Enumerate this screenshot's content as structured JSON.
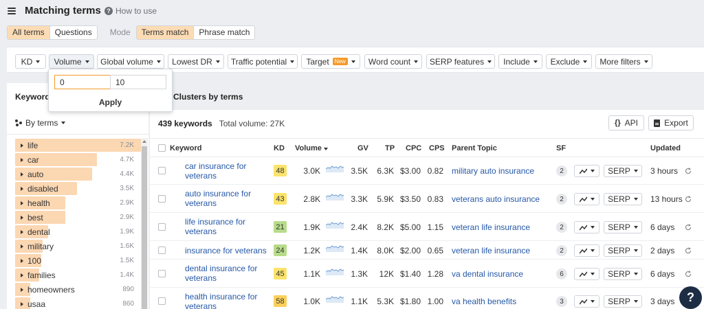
{
  "header": {
    "title": "Matching terms",
    "howto": "How to use"
  },
  "modes": {
    "match_tabs": [
      "All terms",
      "Questions"
    ],
    "mode_label": "Mode",
    "mode_tabs": [
      "Terms match",
      "Phrase match"
    ]
  },
  "filters": [
    {
      "label": "KD"
    },
    {
      "label": "Volume"
    },
    {
      "label": "Global volume"
    },
    {
      "label": "Lowest DR"
    },
    {
      "label": "Traffic potential"
    },
    {
      "label": "Target",
      "badge": "New"
    },
    {
      "label": "Word count"
    },
    {
      "label": "SERP features"
    },
    {
      "label": "Include"
    },
    {
      "label": "Exclude"
    },
    {
      "label": "More filters"
    }
  ],
  "volume_popup": {
    "from_value": "0",
    "to_value": "10",
    "apply_label": "Apply"
  },
  "left_panel": {
    "title": "Keywords",
    "group_by": "By terms",
    "terms": [
      {
        "name": "life",
        "count": "7.2K",
        "share": 1.0
      },
      {
        "name": "car",
        "count": "4.7K",
        "share": 0.65
      },
      {
        "name": "auto",
        "count": "4.4K",
        "share": 0.61
      },
      {
        "name": "disabled",
        "count": "3.5K",
        "share": 0.49
      },
      {
        "name": "health",
        "count": "2.9K",
        "share": 0.4
      },
      {
        "name": "best",
        "count": "2.9K",
        "share": 0.4
      },
      {
        "name": "dental",
        "count": "1.9K",
        "share": 0.26
      },
      {
        "name": "military",
        "count": "1.6K",
        "share": 0.22
      },
      {
        "name": "100",
        "count": "1.5K",
        "share": 0.21
      },
      {
        "name": "families",
        "count": "1.4K",
        "share": 0.19
      },
      {
        "name": "homeowners",
        "count": "890",
        "share": 0.12
      },
      {
        "name": "usaa",
        "count": "860",
        "share": 0.12
      }
    ]
  },
  "clusters_title": "Clusters by terms",
  "summary": {
    "keywords": "439 keywords",
    "total_volume": "Total volume: 27K"
  },
  "buttons": {
    "api": "API",
    "api_icon": "{}",
    "export": "Export"
  },
  "columns": {
    "keyword": "Keyword",
    "kd": "KD",
    "volume": "Volume",
    "gv": "GV",
    "tp": "TP",
    "cpc": "CPC",
    "cps": "CPS",
    "parent": "Parent Topic",
    "sf": "SF",
    "updated": "Updated"
  },
  "rows": [
    {
      "keyword": "car insurance for veterans",
      "kd": "48",
      "kd_color": "#fbe36c",
      "volume": "3.0K",
      "gv": "3.5K",
      "tp": "6.3K",
      "cpc": "$3.00",
      "cps": "0.82",
      "parent": "military auto insurance",
      "sf": "2",
      "serp": "SERP",
      "updated": "3 hours"
    },
    {
      "keyword": "auto insurance for veterans",
      "kd": "43",
      "kd_color": "#fbe36c",
      "volume": "2.8K",
      "gv": "3.3K",
      "tp": "5.9K",
      "cpc": "$3.50",
      "cps": "0.83",
      "parent": "veterans auto insurance",
      "sf": "2",
      "serp": "SERP",
      "updated": "13 hours"
    },
    {
      "keyword": "life insurance for veterans",
      "kd": "21",
      "kd_color": "#b7dc8a",
      "volume": "1.9K",
      "gv": "2.4K",
      "tp": "8.2K",
      "cpc": "$5.00",
      "cps": "1.15",
      "parent": "veteran life insurance",
      "sf": "2",
      "serp": "SERP",
      "updated": "6 days"
    },
    {
      "keyword": "insurance for veterans",
      "kd": "24",
      "kd_color": "#b7dc8a",
      "volume": "1.2K",
      "gv": "1.4K",
      "tp": "8.0K",
      "cpc": "$2.00",
      "cps": "0.65",
      "parent": "veteran life insurance",
      "sf": "2",
      "serp": "SERP",
      "updated": "2 days"
    },
    {
      "keyword": "dental insurance for veterans",
      "kd": "45",
      "kd_color": "#fbe36c",
      "volume": "1.1K",
      "gv": "1.3K",
      "tp": "12K",
      "cpc": "$1.40",
      "cps": "1.28",
      "parent": "va dental insurance",
      "sf": "6",
      "serp": "SERP",
      "updated": "6 days"
    },
    {
      "keyword": "health insurance for veterans",
      "kd": "58",
      "kd_color": "#fbd05a",
      "volume": "1.0K",
      "gv": "1.1K",
      "tp": "5.3K",
      "cpc": "$1.80",
      "cps": "1.00",
      "parent": "va health benefits",
      "sf": "3",
      "serp": "SERP",
      "updated": "3 days"
    }
  ],
  "help_label": "?",
  "colors": {
    "accent": "#f49a2a",
    "term_bar": "#fbd7b2",
    "link": "#2558a7"
  }
}
